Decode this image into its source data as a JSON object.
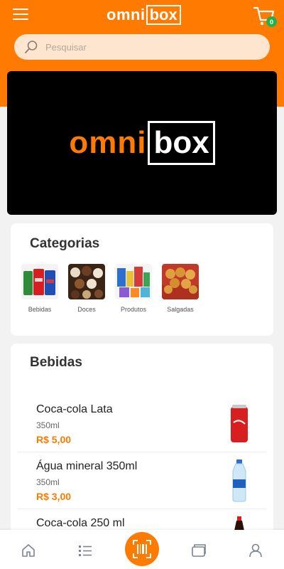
{
  "header": {
    "brand_a": "omni",
    "brand_b": "box",
    "cart_count": "0",
    "accent": "#ff7a00"
  },
  "search": {
    "placeholder": "Pesquisar"
  },
  "banner": {
    "logo_a": "omni",
    "logo_b": "box"
  },
  "categories": {
    "title": "Categorias",
    "items": [
      {
        "label": "Bebidas",
        "icon": "soda-cans-image"
      },
      {
        "label": "Doces",
        "icon": "chocolates-image"
      },
      {
        "label": "Produtos",
        "icon": "grocery-products-image"
      },
      {
        "label": "Salgadas",
        "icon": "snacks-image"
      }
    ]
  },
  "beverages": {
    "title": "Bebidas",
    "products": [
      {
        "name": "Coca-cola Lata",
        "volume": "350ml",
        "price": "R$ 5,00",
        "icon": "coca-cola-can-image"
      },
      {
        "name": "Água mineral 350ml",
        "volume": "350ml",
        "price": "R$ 3,00",
        "icon": "water-bottle-image"
      },
      {
        "name": "Coca-cola 250 ml",
        "volume": "",
        "price": "",
        "icon": "coca-cola-bottle-image"
      }
    ]
  },
  "tabbar": {
    "items": [
      "home-icon",
      "list-icon",
      "barcode-scan-icon",
      "wallet-icon",
      "user-icon"
    ]
  }
}
